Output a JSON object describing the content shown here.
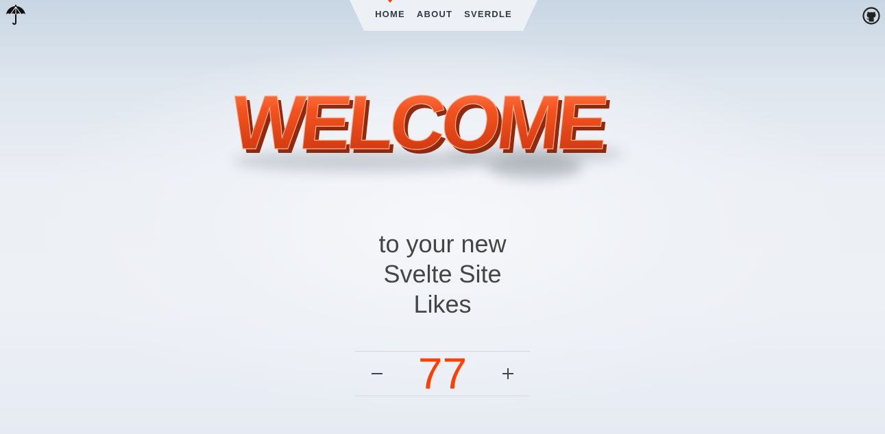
{
  "header": {
    "logo_icon": "umbrella-icon",
    "github_icon": "github-icon",
    "nav": [
      {
        "label": "HOME",
        "active": true
      },
      {
        "label": "ABOUT",
        "active": false
      },
      {
        "label": "SVERDLE",
        "active": false
      }
    ]
  },
  "hero": {
    "welcome_text": "WELCOME",
    "subtitle_line1": "to your new",
    "subtitle_line2": "Svelte Site",
    "subtitle_line3": "Likes"
  },
  "counter": {
    "value": "77",
    "decrement_icon": "minus-icon",
    "increment_icon": "plus-icon"
  },
  "colors": {
    "accent": "#ff3e00",
    "text": "#454545",
    "nav_text": "#2f3a45"
  }
}
